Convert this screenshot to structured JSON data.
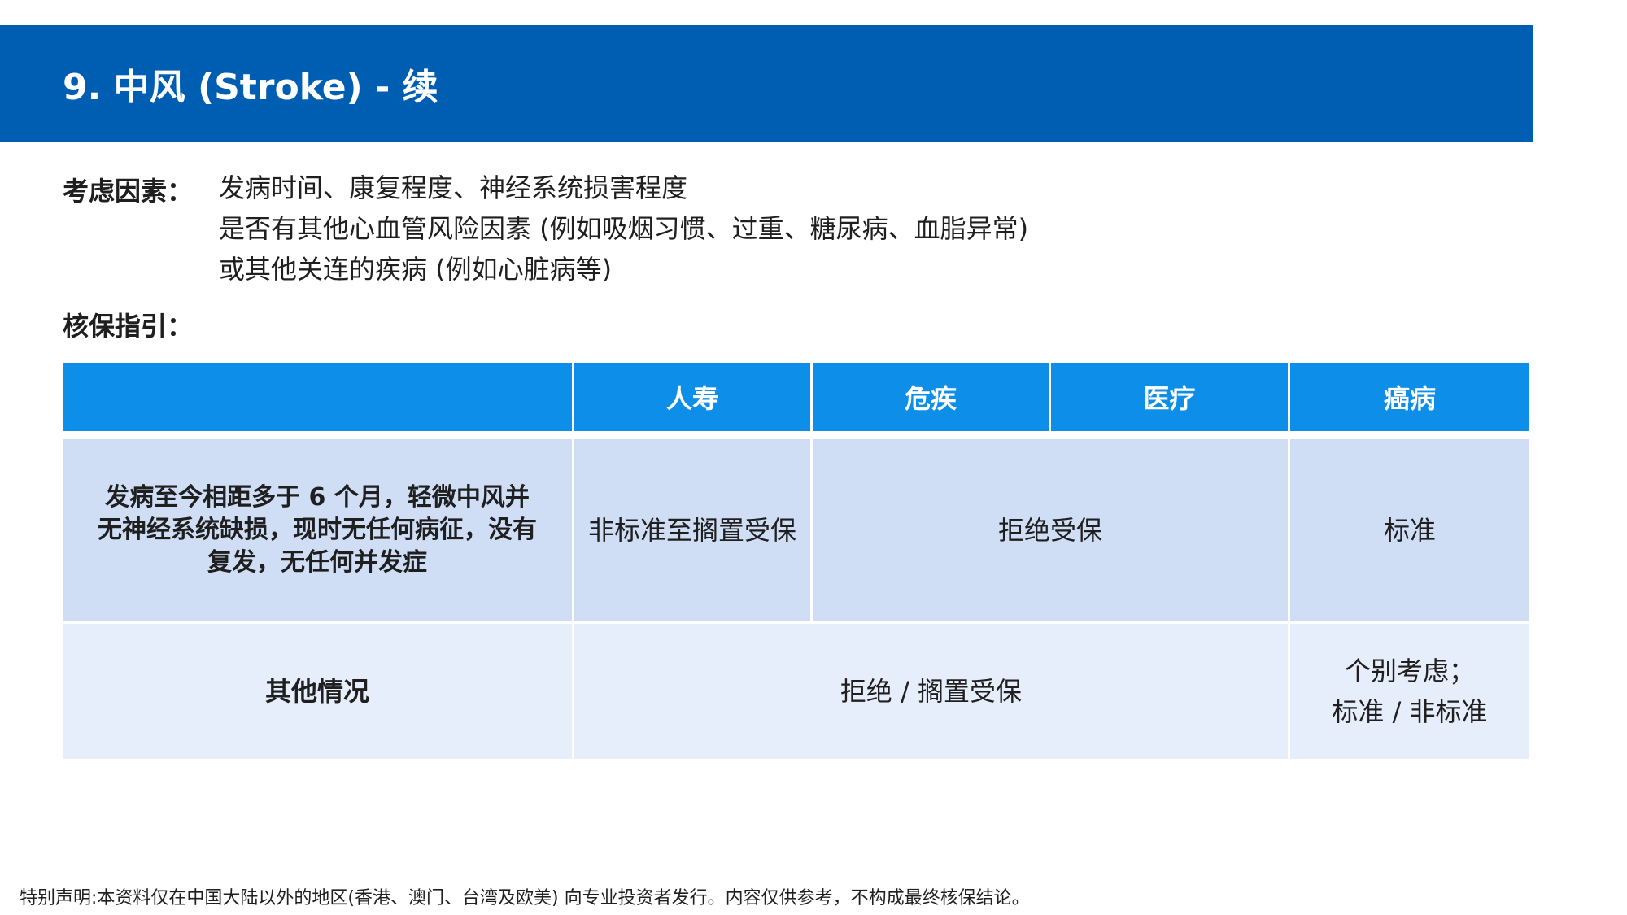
{
  "header": {
    "title": "9. 中风 (Stroke)  - 续"
  },
  "factors": {
    "label": "考虑因素：",
    "lines": [
      "发病时间、康复程度、神经系统损害程度",
      "是否有其他心血管风险因素 (例如吸烟习惯、过重、糖尿病、血脂异常)",
      "或其他关连的疾病 (例如心脏病等)"
    ]
  },
  "guideline": {
    "label": "核保指引："
  },
  "table": {
    "headers": [
      "",
      "人寿",
      "危疾",
      "医疗",
      "癌病"
    ],
    "row1": {
      "condition": "发病至今相距多于 6 个月，轻微中风并无神经系统缺损，现时无任何病征，没有复发，无任何并发症",
      "life": "非标准至搁置受保",
      "ci_medical": "拒绝受保",
      "cancer": "标准"
    },
    "row2": {
      "condition": "其他情况",
      "life_ci_medical": "拒绝 / 搁置受保",
      "cancer_line1": "个别考虑；",
      "cancer_line2": "标准 / 非标准"
    }
  },
  "footer": {
    "disclaimer": "特别声明:本资料仅在中国大陆以外的地区(香港、澳门、台湾及欧美) 向专业投资者发行。内容仅供参考，不构成最终核保结论。"
  },
  "colors": {
    "title_bar": "#005eb2",
    "table_header": "#0d8ee8",
    "row1_bg": "#cfdef5",
    "row2_bg": "#e7eefb"
  }
}
